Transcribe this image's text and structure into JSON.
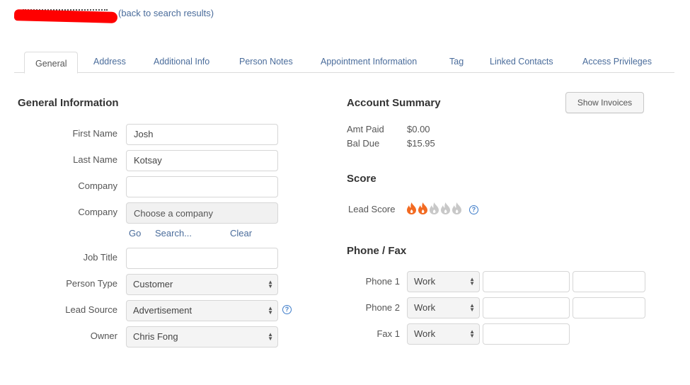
{
  "header": {
    "title_redacted": true,
    "back_link": "(back to search results)"
  },
  "tabs": [
    {
      "label": "General",
      "active": true
    },
    {
      "label": "Address",
      "active": false
    },
    {
      "label": "Additional Info",
      "active": false
    },
    {
      "label": "Person Notes",
      "active": false
    },
    {
      "label": "Appointment Information",
      "active": false
    },
    {
      "label": "Tag",
      "active": false
    },
    {
      "label": "Linked Contacts",
      "active": false
    },
    {
      "label": "Access Privileges",
      "active": false
    }
  ],
  "general": {
    "title": "General Information",
    "fields": {
      "first_name": {
        "label": "First Name",
        "value": "Josh"
      },
      "last_name": {
        "label": "Last Name",
        "value": "Kotsay"
      },
      "company_text": {
        "label": "Company",
        "value": ""
      },
      "company_select": {
        "label": "Company",
        "placeholder": "Choose a company"
      },
      "company_links": {
        "go": "Go",
        "search": "Search...",
        "clear": "Clear"
      },
      "job_title": {
        "label": "Job Title",
        "value": ""
      },
      "person_type": {
        "label": "Person Type",
        "value": "Customer"
      },
      "lead_source": {
        "label": "Lead Source",
        "value": "Advertisement"
      },
      "owner": {
        "label": "Owner",
        "value": "Chris Fong"
      }
    },
    "help_glyph": "?"
  },
  "account": {
    "title": "Account Summary",
    "show_invoices": "Show Invoices",
    "amt_paid_label": "Amt Paid",
    "amt_paid": "$0.00",
    "bal_due_label": "Bal Due",
    "bal_due": "$15.95"
  },
  "score": {
    "title": "Score",
    "lead_score_label": "Lead Score",
    "lead_score": 2,
    "lead_score_max": 5,
    "colors": {
      "active": "#f26a21",
      "inactive": "#c8c8c8"
    },
    "help_glyph": "?"
  },
  "phone": {
    "title": "Phone / Fax",
    "rows": [
      {
        "label": "Phone 1",
        "type": "Work",
        "number": "",
        "ext": ""
      },
      {
        "label": "Phone 2",
        "type": "Work",
        "number": "",
        "ext": ""
      },
      {
        "label": "Fax 1",
        "type": "Work",
        "number": ""
      }
    ]
  },
  "colors": {
    "link": "#4a6c9b",
    "redaction": "#ff0000",
    "help": "#3d7cc9"
  }
}
